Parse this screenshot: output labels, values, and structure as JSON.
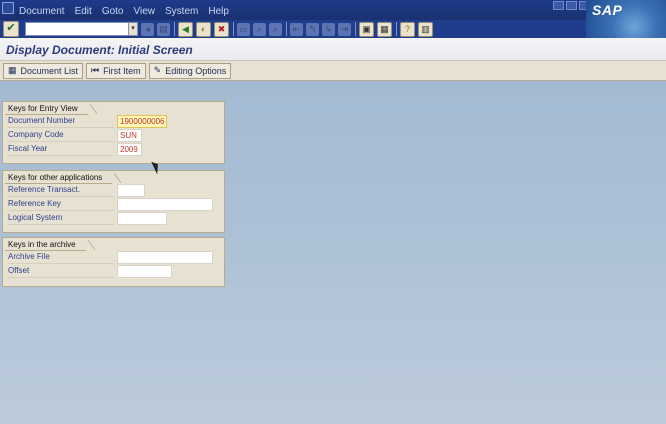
{
  "menubar": {
    "items": [
      "Document",
      "Edit",
      "Goto",
      "View",
      "System",
      "Help"
    ],
    "logo_text": "SAP"
  },
  "toolbar": {
    "command_field_value": "",
    "icons": [
      "ok-icon",
      "dropdown-icon",
      "back-nav-icon",
      "save-icon",
      "back-icon",
      "exit-icon",
      "cancel-icon",
      "print-icon",
      "find-icon",
      "find-next-icon",
      "first-page-icon",
      "prev-page-icon",
      "next-page-icon",
      "last-page-icon",
      "new-session-icon",
      "shortcut-icon",
      "help-icon",
      "layout-icon"
    ]
  },
  "title": "Display Document: Initial Screen",
  "app_toolbar": {
    "document_list": "Document List",
    "first_item": "First Item",
    "editing_options": "Editing Options"
  },
  "groups": {
    "entry_view": {
      "title": "Keys for Entry View",
      "fields": [
        {
          "label": "Document Number",
          "value": "1900000006"
        },
        {
          "label": "Company Code",
          "value": "SUN"
        },
        {
          "label": "Fiscal Year",
          "value": "2009"
        }
      ]
    },
    "other_apps": {
      "title": "Keys for other applications",
      "fields": [
        {
          "label": "Reference Transact.",
          "value": ""
        },
        {
          "label": "Reference Key",
          "value": ""
        },
        {
          "label": "Logical System",
          "value": ""
        }
      ]
    },
    "archive": {
      "title": "Keys in the archive",
      "fields": [
        {
          "label": "Archive File",
          "value": ""
        },
        {
          "label": "Offset",
          "value": ""
        }
      ]
    }
  }
}
